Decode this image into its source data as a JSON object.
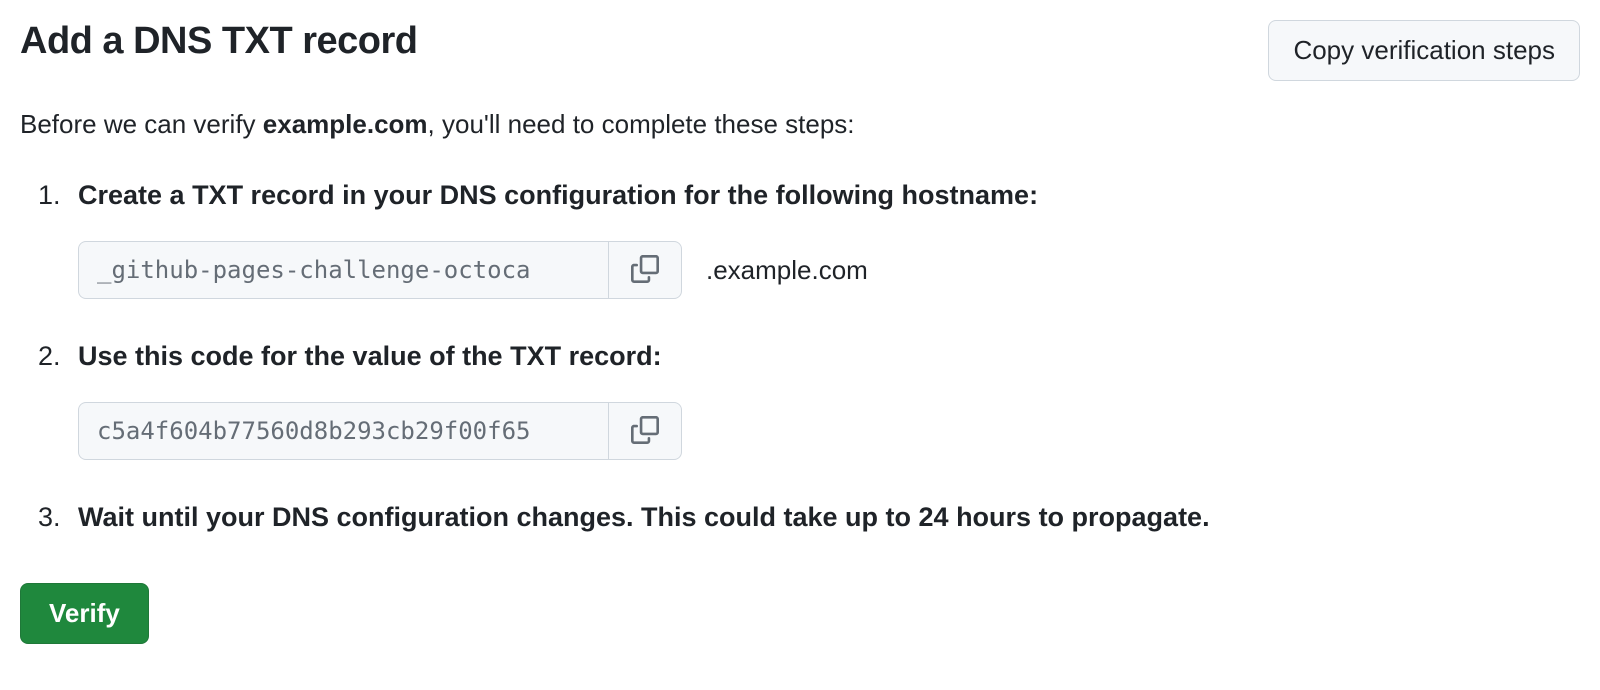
{
  "header": {
    "title": "Add a DNS TXT record",
    "copy_steps_label": "Copy verification steps"
  },
  "intro": {
    "prefix": "Before we can verify ",
    "domain": "example.com",
    "suffix": ", you'll need to complete these steps:"
  },
  "steps": {
    "step1": {
      "label": "Create a TXT record in your DNS configuration for the following hostname:",
      "hostname_value": "_github-pages-challenge-octoca",
      "hostname_suffix": ".example.com"
    },
    "step2": {
      "label": "Use this code for the value of the TXT record:",
      "code_value": "c5a4f604b77560d8b293cb29f00f65"
    },
    "step3": {
      "label": "Wait until your DNS configuration changes. This could take up to 24 hours to propagate."
    }
  },
  "actions": {
    "verify_label": "Verify"
  }
}
